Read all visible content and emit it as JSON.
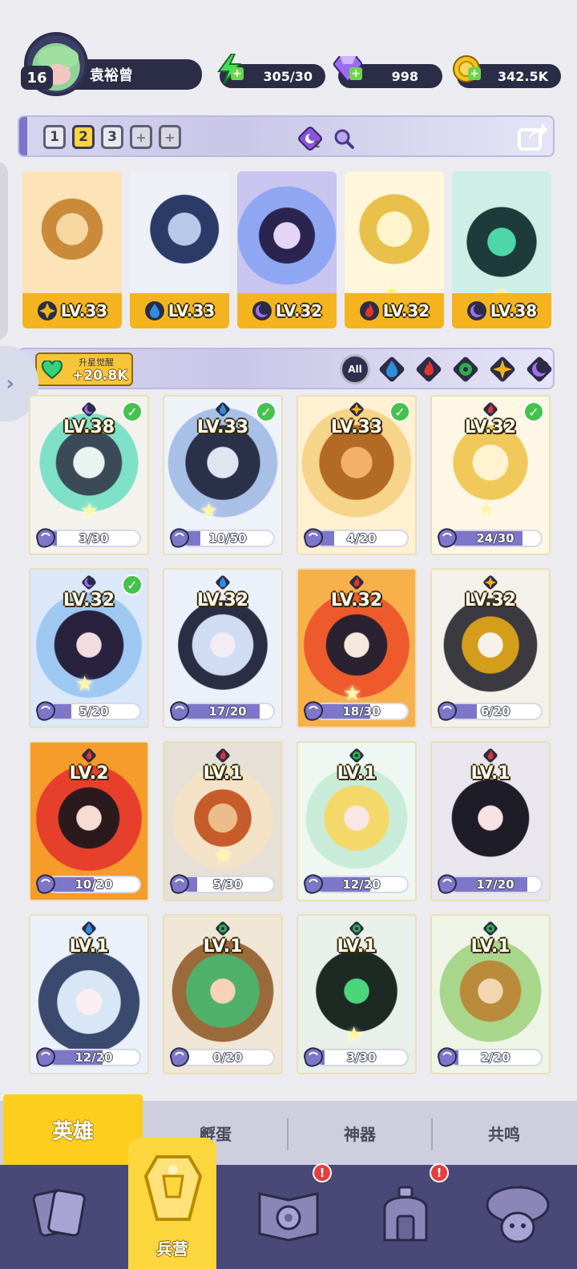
{
  "profile": {
    "level": "16",
    "name": "袁裕曾"
  },
  "resources": {
    "energy": "305/30",
    "gems": "998",
    "coins": "342.5K"
  },
  "team_bar": {
    "slots": [
      "1",
      "2",
      "3"
    ],
    "active_slot": "2",
    "add_labels": [
      "+",
      "+"
    ],
    "summon_count": "2"
  },
  "team": [
    {
      "element": "light",
      "level": "LV.33"
    },
    {
      "element": "water",
      "level": "LV.33"
    },
    {
      "element": "dark",
      "level": "LV.32"
    },
    {
      "element": "fire",
      "level": "LV.32"
    },
    {
      "element": "dark",
      "level": "LV.38"
    }
  ],
  "awaken": {
    "title": "升星觉醒",
    "value": "+20.8K"
  },
  "filters": {
    "all_label": "All",
    "elements": [
      "water",
      "fire",
      "nature",
      "light",
      "dark"
    ]
  },
  "heroes": [
    {
      "element": "dark",
      "level": "LV.38",
      "progress": "3/30",
      "checked": true,
      "ratio": 0.1
    },
    {
      "element": "water",
      "level": "LV.33",
      "progress": "10/50",
      "checked": true,
      "ratio": 0.2
    },
    {
      "element": "light",
      "level": "LV.33",
      "progress": "4/20",
      "checked": true,
      "ratio": 0.2
    },
    {
      "element": "fire",
      "level": "LV.32",
      "progress": "24/30",
      "checked": true,
      "ratio": 0.8
    },
    {
      "element": "dark",
      "level": "LV.32",
      "progress": "5/20",
      "checked": true,
      "ratio": 0.25
    },
    {
      "element": "water",
      "level": "LV.32",
      "progress": "17/20",
      "checked": false,
      "ratio": 0.85
    },
    {
      "element": "fire",
      "level": "LV.32",
      "progress": "18/30",
      "checked": false,
      "ratio": 0.6
    },
    {
      "element": "light",
      "level": "LV.32",
      "progress": "6/20",
      "checked": false,
      "ratio": 0.3
    },
    {
      "element": "fire",
      "level": "LV.2",
      "progress": "10/20",
      "checked": false,
      "ratio": 0.5
    },
    {
      "element": "fire",
      "level": "LV.1",
      "progress": "5/30",
      "checked": false,
      "ratio": 0.17
    },
    {
      "element": "nature",
      "level": "LV.1",
      "progress": "12/20",
      "checked": false,
      "ratio": 0.6
    },
    {
      "element": "fire",
      "level": "LV.1",
      "progress": "17/20",
      "checked": false,
      "ratio": 0.85
    },
    {
      "element": "water",
      "level": "LV.1",
      "progress": "12/20",
      "checked": false,
      "ratio": 0.6
    },
    {
      "element": "nature",
      "level": "LV.1",
      "progress": "0/20",
      "checked": false,
      "ratio": 0.0
    },
    {
      "element": "nature",
      "level": "LV.1",
      "progress": "3/30",
      "checked": false,
      "ratio": 0.1
    },
    {
      "element": "nature",
      "level": "LV.1",
      "progress": "2/20",
      "checked": false,
      "ratio": 0.1
    }
  ],
  "subtabs": [
    "英雄",
    "孵蛋",
    "神器",
    "共鸣"
  ],
  "nav": {
    "active_label": "兵营",
    "badges": [
      "!",
      "!"
    ]
  },
  "colors": {
    "water": "#2f8de0",
    "fire": "#e2342c",
    "nature": "#2fae4a",
    "light": "#f2b318",
    "dark": "#7d3fd0",
    "card_gold": "#f2c226",
    "panel_dark": "#2b2d47",
    "nav_bg": "#4a4877"
  }
}
